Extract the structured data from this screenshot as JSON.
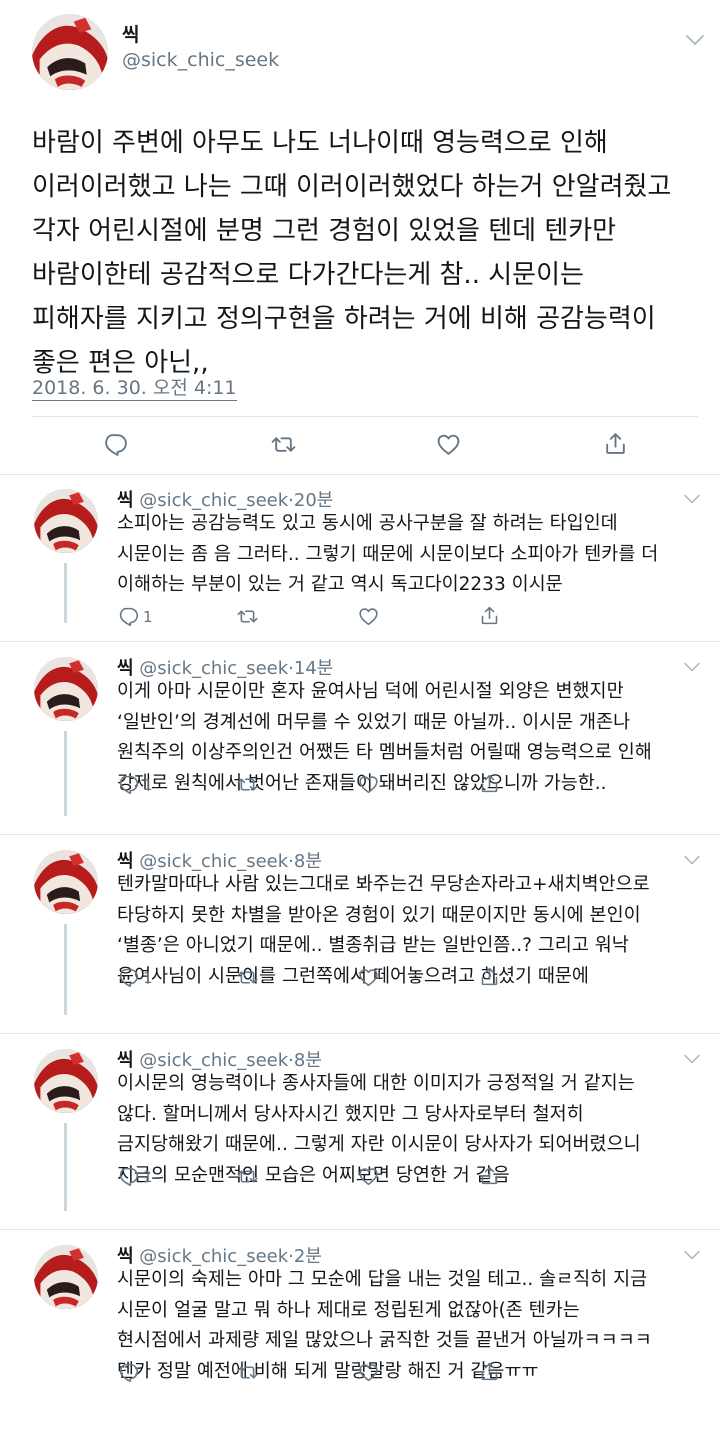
{
  "main": {
    "name": "씩",
    "handle": "@sick_chic_seek",
    "text": "바람이 주변에 아무도 나도 너나이때 영능력으로 인해\n이러이러했고 나는 그때 이러이러했었다 하는거 안알려줬고\n각자 어린시절에 분명 그런 경험이 있었을 텐데 텐카만\n바람이한테 공감적으로 다가간다는게 참.. 시문이는\n피해자를 지키고 정의구현을 하려는 거에 비해 공감능력이\n좋은 편은 아닌,,",
    "timestamp": "2018. 6. 30. 오전 4:11"
  },
  "replies": [
    {
      "name": "씩",
      "handle": "@sick_chic_seek",
      "sep": "·",
      "time": "20분",
      "text": "소피아는 공감능력도 있고 동시에 공사구분을 잘 하려는 타입인데\n시문이는 좀 음 그러타.. 그렇기 때문에 시문이보다 소피아가 텐카를 더\n이해하는 부분이 있는 거 같고 역시 독고다이2233 이시문",
      "reply_count": "1",
      "retweet_count": "",
      "like_count": ""
    },
    {
      "name": "씩",
      "handle": "@sick_chic_seek",
      "sep": "·",
      "time": "14분",
      "text": "이게 아마 시문이만 혼자 윤여사님 덕에 어린시절 외양은 변했지만\n‘일반인’의 경계선에 머무를 수 있었기 때문 아닐까.. 이시문 개존나\n원칙주의 이상주의인건 어쨌든 타 멤버들처럼 어릴때 영능력으로 인해\n강제로 원칙에서 벗어난 존재들이 돼버리진 않았으니까 가능한..",
      "reply_count": "1",
      "retweet_count": "",
      "like_count": ""
    },
    {
      "name": "씩",
      "handle": "@sick_chic_seek",
      "sep": "·",
      "time": "8분",
      "text": "텐카말마따나 사람 있는그대로 봐주는건 무당손자라고+새치벽안으로\n타당하지 못한 차별을 받아온 경험이 있기 때문이지만 동시에 본인이\n‘별종’은 아니었기 때문에.. 별종취급 받는 일반인쯤..? 그리고 워낙\n윤여사님이 시문이를 그런쪽에서 떼어놓으려고 하셨기 때문에",
      "reply_count": "1",
      "retweet_count": "",
      "like_count": ""
    },
    {
      "name": "씩",
      "handle": "@sick_chic_seek",
      "sep": "·",
      "time": "8분",
      "text": "이시문의 영능력이나 종사자들에 대한 이미지가 긍정적일 거 같지는\n않다. 할머니께서 당사자시긴 했지만 그 당사자로부터 철저히\n금지당해왔기 때문에.. 그렇게 자란 이시문이 당사자가 되어버렸으니\n지금의 모순맨적인 모습은 어찌보면 당연한 거 같음",
      "reply_count": "1",
      "retweet_count": "",
      "like_count": ""
    },
    {
      "name": "씩",
      "handle": "@sick_chic_seek",
      "sep": "·",
      "time": "2분",
      "text": "시문이의 숙제는 아마 그 모순에 답을 내는 것일 테고.. 솔ㄹ직히 지금\n시문이 얼굴 말고 뭐 하나 제대로 정립된게 없잖아(존 텐카는\n현시점에서 과제량 제일 많았으나 굵직한 것들 끝낸거 아닐까ㅋㅋㅋㅋ\n텐카 정말 예전에 비해 되게 말랑말랑 해진 거 같음ㅠㅠ",
      "reply_count": "",
      "retweet_count": "",
      "like_count": ""
    }
  ],
  "icons": {
    "reply": "reply-icon",
    "retweet": "retweet-icon",
    "like": "heart-icon",
    "share": "share-icon",
    "more": "chevron-down-icon"
  },
  "colors": {
    "text": "#14171a",
    "secondary": "#657786",
    "divider": "#e1e8ed",
    "thread_line": "#ccd6dd"
  }
}
